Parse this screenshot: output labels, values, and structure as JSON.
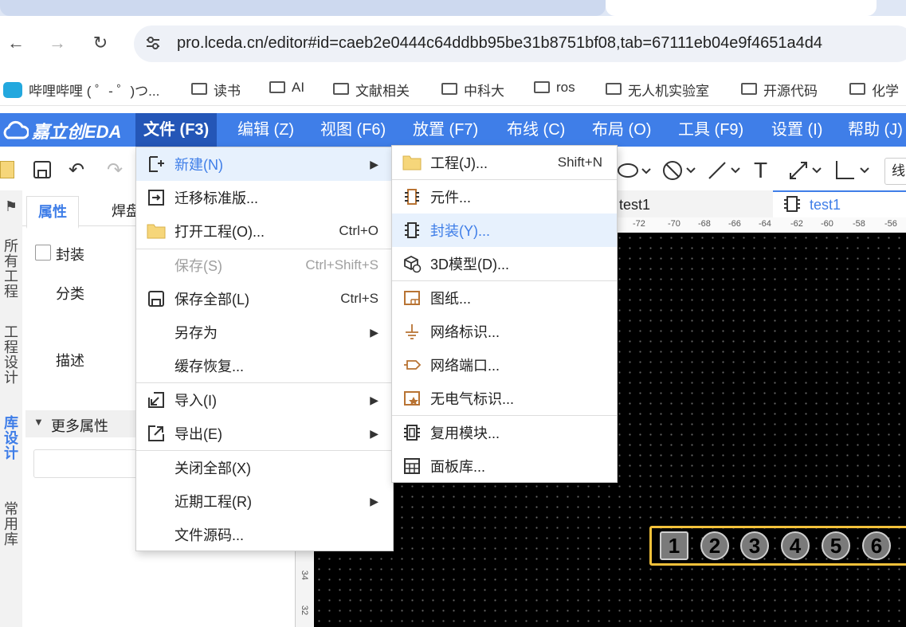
{
  "browser": {
    "url": "pro.lceda.cn/editor#id=caeb2e0444c64ddbb95be31b8751bf08,tab=67111eb04e9f4651a4d4",
    "bookmarks": [
      "哔哩哔哩 ( ゜- ゜)つ...",
      "读书",
      "AI",
      "文献相关",
      "中科大",
      "ros",
      "无人机实验室",
      "开源代码",
      "化学"
    ]
  },
  "app": {
    "logo": "嘉立创EDA",
    "menu": [
      "文件 (F3)",
      "编辑 (Z)",
      "视图 (F6)",
      "放置 (F7)",
      "布线 (C)",
      "布局 (O)",
      "工具 (F9)",
      "设置 (I)",
      "帮助 (J)"
    ],
    "toolbar_cut_text": "线"
  },
  "left": {
    "vtabs": [
      "所有工程",
      "工程设计",
      "库设计",
      "常用库"
    ],
    "pin_icon": "pin-icon",
    "panel_tabs": [
      "属性",
      "焊盘"
    ],
    "checkbox_label": "封装",
    "field_category": "分类",
    "field_desc": "描述",
    "more_props": "更多属性",
    "ruler_labels": [
      "34",
      "32"
    ]
  },
  "file_menu": [
    {
      "label": "新建(N)",
      "shortcut": "",
      "submenu": true,
      "highlighted": true,
      "disabled": false,
      "icon": "new-file-icon"
    },
    {
      "label": "迁移标准版...",
      "shortcut": "",
      "submenu": false,
      "disabled": false,
      "icon": "migrate-icon"
    },
    {
      "label": "打开工程(O)...",
      "shortcut": "Ctrl+O",
      "submenu": false,
      "disabled": false,
      "icon": "folder-icon"
    },
    {
      "label": "保存(S)",
      "shortcut": "Ctrl+Shift+S",
      "submenu": false,
      "disabled": true,
      "icon": ""
    },
    {
      "label": "保存全部(L)",
      "shortcut": "Ctrl+S",
      "submenu": false,
      "disabled": false,
      "icon": "save-all-icon"
    },
    {
      "label": "另存为",
      "shortcut": "",
      "submenu": true,
      "disabled": false,
      "icon": ""
    },
    {
      "label": "缓存恢复...",
      "shortcut": "",
      "submenu": false,
      "disabled": false,
      "icon": ""
    },
    {
      "label": "导入(I)",
      "shortcut": "",
      "submenu": true,
      "disabled": false,
      "icon": "import-icon"
    },
    {
      "label": "导出(E)",
      "shortcut": "",
      "submenu": true,
      "disabled": false,
      "icon": "export-icon"
    },
    {
      "label": "关闭全部(X)",
      "shortcut": "",
      "submenu": false,
      "disabled": false,
      "icon": ""
    },
    {
      "label": "近期工程(R)",
      "shortcut": "",
      "submenu": true,
      "disabled": false,
      "icon": ""
    },
    {
      "label": "文件源码...",
      "shortcut": "",
      "submenu": false,
      "disabled": false,
      "icon": ""
    }
  ],
  "new_submenu": [
    {
      "label": "工程(J)...",
      "shortcut": "Shift+N",
      "icon": "folder-icon"
    },
    {
      "label": "元件...",
      "shortcut": "",
      "icon": "component-icon"
    },
    {
      "label": "封装(Y)...",
      "shortcut": "",
      "icon": "footprint-icon",
      "highlighted": true
    },
    {
      "label": "3D模型(D)...",
      "shortcut": "",
      "icon": "3d-model-icon"
    },
    {
      "label": "图纸...",
      "shortcut": "",
      "icon": "sheet-icon"
    },
    {
      "label": "网络标识...",
      "shortcut": "",
      "icon": "net-label-icon"
    },
    {
      "label": "网络端口...",
      "shortcut": "",
      "icon": "net-port-icon"
    },
    {
      "label": "无电气标识...",
      "shortcut": "",
      "icon": "non-electrical-icon"
    },
    {
      "label": "复用模块...",
      "shortcut": "",
      "icon": "reuse-module-icon"
    },
    {
      "label": "面板库...",
      "shortcut": "",
      "icon": "panel-lib-icon"
    }
  ],
  "editor": {
    "doc_tabs": [
      "test1",
      "test1"
    ],
    "ruler_top": [
      "-72",
      "-70",
      "-68",
      "-66",
      "-64",
      "-62",
      "-60",
      "-58",
      "-56"
    ],
    "pads": [
      "1",
      "2",
      "3",
      "4",
      "5",
      "6"
    ]
  }
}
